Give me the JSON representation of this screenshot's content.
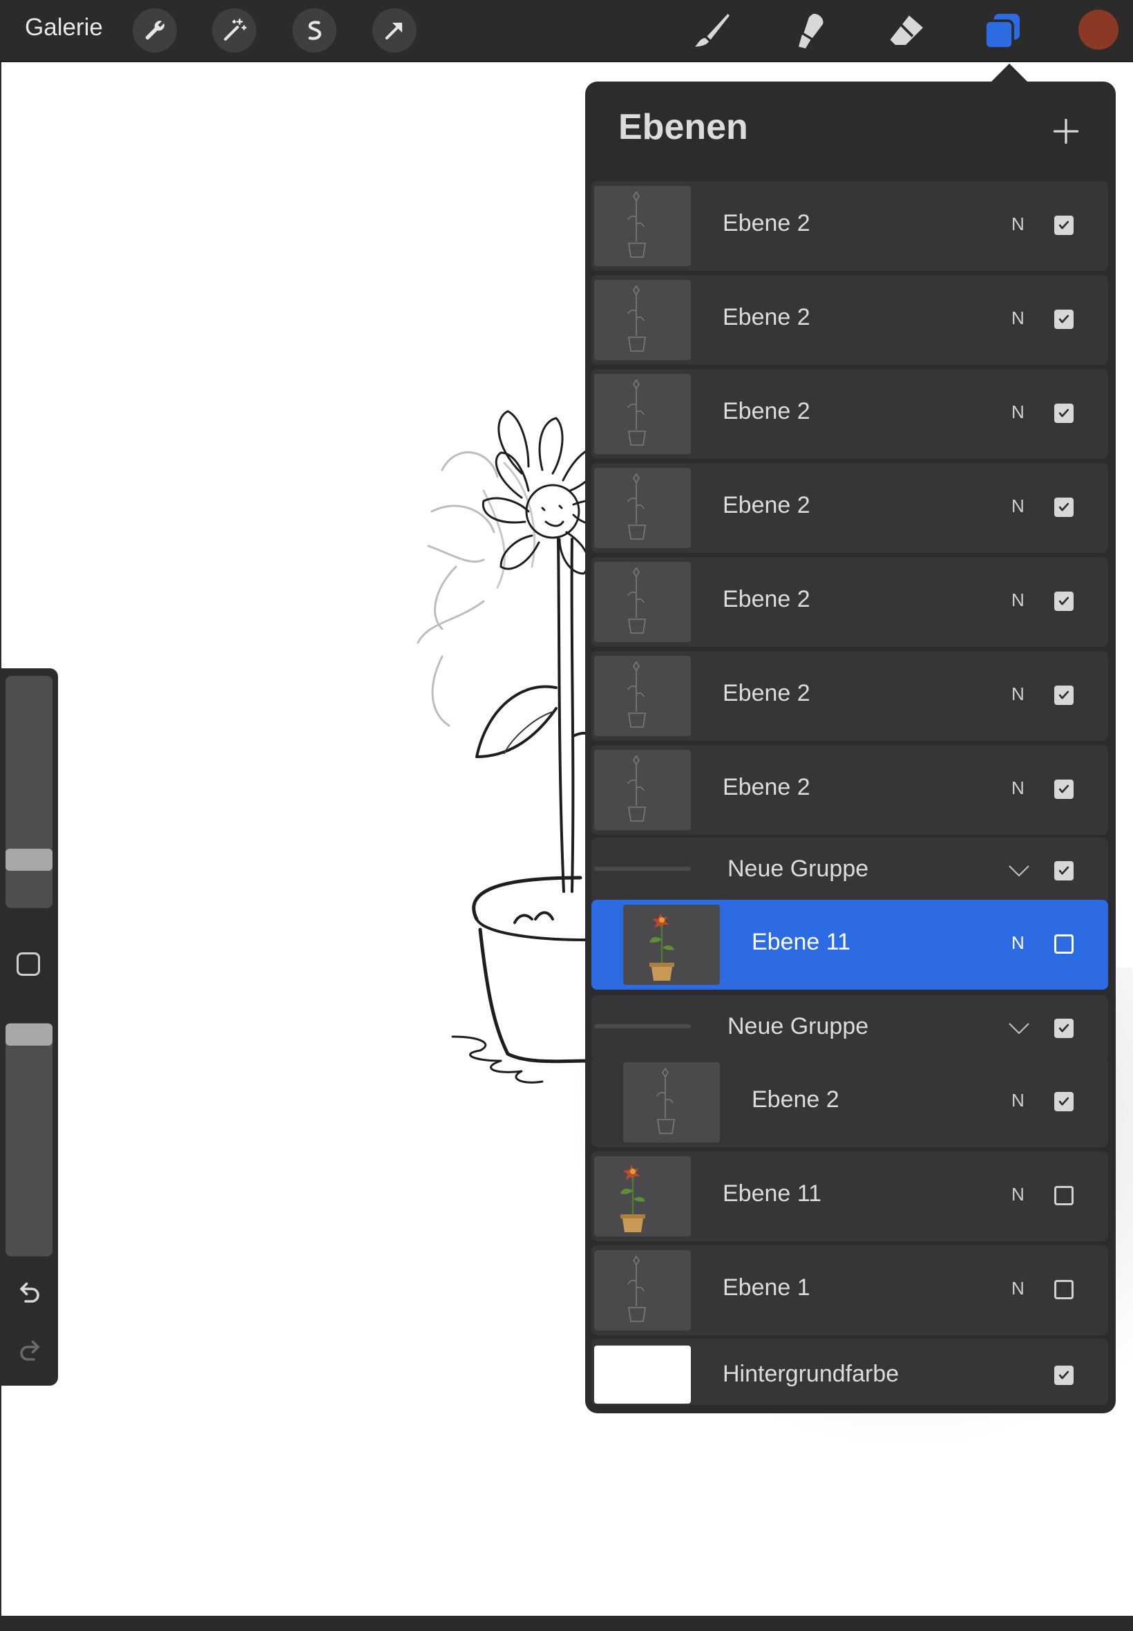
{
  "topbar": {
    "gallery_label": "Galerie",
    "left_tools": [
      "wrench-icon",
      "magic-wand-icon",
      "selection-s-icon",
      "transform-arrow-icon"
    ],
    "right_tools": [
      "brush-icon",
      "smudge-icon",
      "eraser-icon",
      "layers-icon"
    ],
    "accent_color": "#2d6be3",
    "current_color": "#8a3a24"
  },
  "layers_panel": {
    "title": "Ebenen",
    "add_icon": "plus-icon",
    "layers": [
      {
        "name": "Ebene 2",
        "blend": "N",
        "visible": true
      },
      {
        "name": "Ebene 2",
        "blend": "N",
        "visible": true
      },
      {
        "name": "Ebene 2",
        "blend": "N",
        "visible": true
      },
      {
        "name": "Ebene 2",
        "blend": "N",
        "visible": true
      },
      {
        "name": "Ebene 2",
        "blend": "N",
        "visible": true
      },
      {
        "name": "Ebene 2",
        "blend": "N",
        "visible": true
      },
      {
        "name": "Ebene 2",
        "blend": "N",
        "visible": true
      },
      {
        "name": "Neue Gruppe",
        "type": "group",
        "visible": true
      },
      {
        "name": "Ebene 11",
        "blend": "N",
        "visible": false,
        "selected": true,
        "in_group": true
      },
      {
        "name": "Neue Gruppe",
        "type": "group",
        "visible": true
      },
      {
        "name": "Ebene 2",
        "blend": "N",
        "visible": true,
        "in_group": true
      },
      {
        "name": "Ebene 11",
        "blend": "N",
        "visible": false
      },
      {
        "name": "Ebene 1",
        "blend": "N",
        "visible": false
      },
      {
        "name": "Hintergrundfarbe",
        "type": "background",
        "visible": true
      }
    ]
  },
  "sidebar": {
    "brush_size_level": 0.2,
    "opacity_level": 0.94,
    "icons": [
      "modifier-square-icon",
      "undo-icon",
      "redo-icon"
    ]
  }
}
